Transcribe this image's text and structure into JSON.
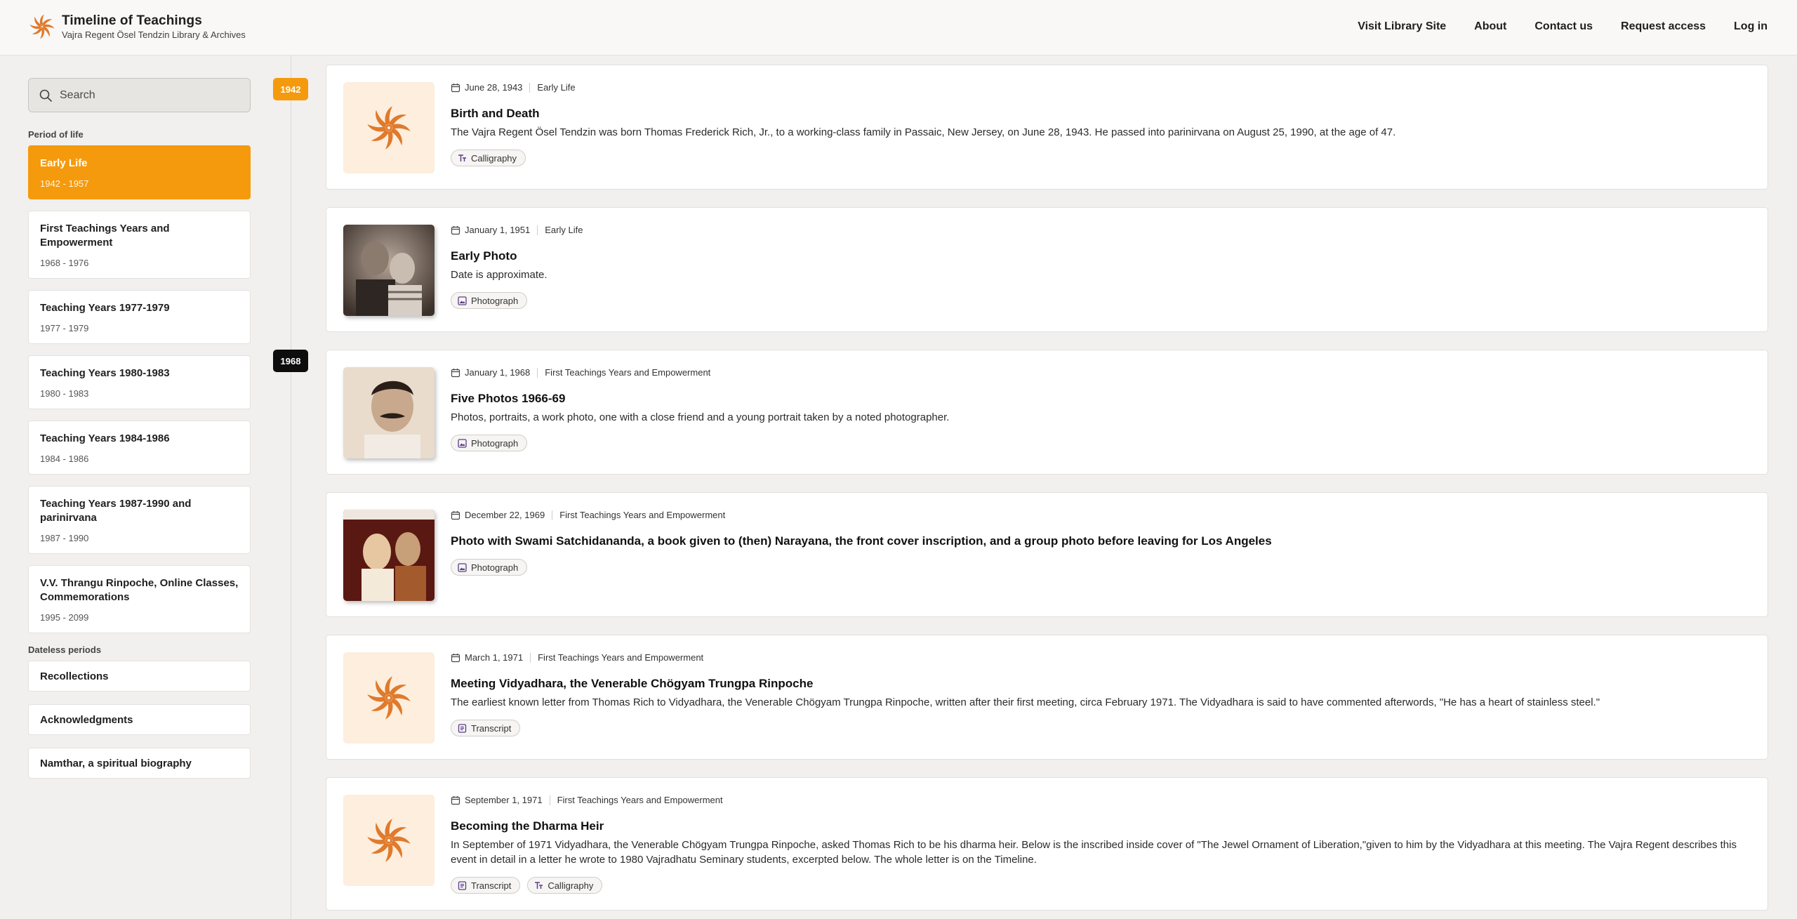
{
  "header": {
    "title": "Timeline of Teachings",
    "subtitle": "Vajra Regent Ösel Tendzin Library & Archives",
    "nav": [
      "Visit Library Site",
      "About",
      "Contact us",
      "Request access",
      "Log in"
    ]
  },
  "colors": {
    "accent": "#f59a0d",
    "logo": "#e07a2c",
    "thumb_bg": "#fdeedd"
  },
  "search": {
    "placeholder": "Search"
  },
  "sidebar": {
    "period_label": "Period of life",
    "periods": [
      {
        "title": "Early Life",
        "range": "1942 - 1957",
        "active": true
      },
      {
        "title": "First Teachings Years and Empowerment",
        "range": "1968 - 1976"
      },
      {
        "title": "Teaching Years 1977-1979",
        "range": "1977 - 1979"
      },
      {
        "title": "Teaching Years 1980-1983",
        "range": "1980 - 1983"
      },
      {
        "title": "Teaching Years 1984-1986",
        "range": "1984 - 1986"
      },
      {
        "title": "Teaching Years 1987-1990 and parinirvana",
        "range": "1987 - 1990"
      },
      {
        "title": "V.V. Thrangu Rinpoche, Online Classes, Commemorations",
        "range": "1995 - 2099"
      }
    ],
    "dateless_label": "Dateless periods",
    "dateless": [
      "Recollections",
      "Acknowledgments",
      "Namthar, a spiritual biography"
    ]
  },
  "timeline": {
    "years": [
      "1942",
      "1968"
    ],
    "entries": [
      {
        "date": "June 28, 1943",
        "period": "Early Life",
        "title": "Birth and Death",
        "description": "The Vajra Regent Ösel Tendzin was born Thomas Frederick Rich, Jr., to a working-class family in Passaic, New Jersey, on June 28, 1943. He passed into parinirvana on August 25, 1990, at the age of 47.",
        "tags": [
          "Calligraphy"
        ]
      },
      {
        "date": "January 1, 1951",
        "period": "Early Life",
        "title": "Early Photo",
        "description": "Date is approximate.",
        "tags": [
          "Photograph"
        ]
      },
      {
        "date": "January 1, 1968",
        "period": "First Teachings Years and Empowerment",
        "title": "Five Photos 1966-69",
        "description": "Photos, portraits, a work photo, one with a close friend and a young portrait taken by a noted photographer.",
        "tags": [
          "Photograph"
        ]
      },
      {
        "date": "December 22, 1969",
        "period": "First Teachings Years and Empowerment",
        "title": "Photo with Swami Satchidananda, a book given to (then) Narayana, the front cover inscription, and a group photo before leaving for Los Angeles",
        "description": "",
        "tags": [
          "Photograph"
        ]
      },
      {
        "date": "March 1, 1971",
        "period": "First Teachings Years and Empowerment",
        "title": "Meeting Vidyadhara, the Venerable Chögyam Trungpa Rinpoche",
        "description": "The earliest known letter from Thomas Rich to Vidyadhara, the Venerable Chögyam Trungpa Rinpoche, written after their first meeting, circa February 1971. The Vidyadhara is said to have commented afterwords, \"He has a heart of stainless steel.\"",
        "tags": [
          "Transcript"
        ]
      },
      {
        "date": "September 1, 1971",
        "period": "First Teachings Years and Empowerment",
        "title": "Becoming the Dharma Heir",
        "description": "In September of 1971 Vidyadhara, the Venerable Chögyam Trungpa Rinpoche, asked Thomas Rich to be his dharma heir. Below is the inscribed inside cover of \"The Jewel Ornament of Liberation,\"given to him by the Vidyadhara at this meeting. The Vajra Regent describes this event in detail in a letter he wrote to 1980 Vajradhatu Seminary students, excerpted below. The whole letter is on the Timeline.",
        "tags": [
          "Transcript",
          "Calligraphy"
        ]
      }
    ]
  }
}
